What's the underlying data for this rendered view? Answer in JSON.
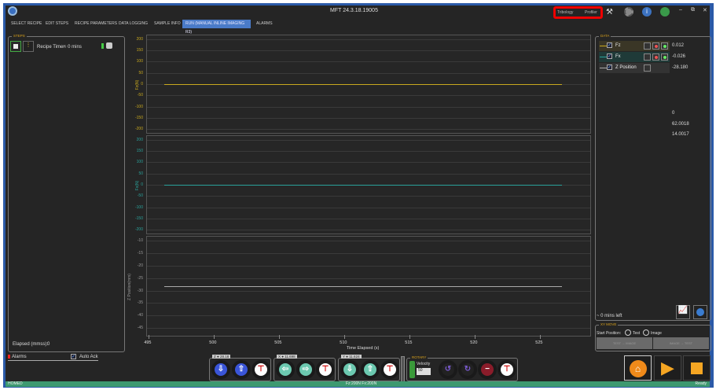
{
  "title": "MFT 24.3.18.19005",
  "header_links": [
    "Tribology",
    "Profiler"
  ],
  "tabs": [
    "SELECT RECIPE",
    "EDIT STEPS",
    "RECIPE PARAMETERS",
    "DATA LOGGING",
    "SAMPLE INFO",
    "RUN (MANUAL INLINE IMAGING R3)",
    "ALARMS"
  ],
  "active_tab": 5,
  "steps": {
    "label": "STEPS",
    "recipe_timer_label": "Recipe Timer:",
    "recipe_timer_value": "~ 0 mins",
    "elapsed_label": "Elapsed (mmss):",
    "elapsed_value": "0"
  },
  "alarms": {
    "label": "Alarms",
    "auto_ack": "Auto Ack"
  },
  "data_panel": {
    "label": "DATA",
    "rows": [
      {
        "name": "Fz",
        "value": "0.012",
        "color": "#c8a81e"
      },
      {
        "name": "Fx",
        "value": "-0.026",
        "color": "#2aa19a"
      },
      {
        "name": "Z Position",
        "value": "-28.180",
        "color": "#aaaaaa"
      }
    ],
    "extra_values": [
      "0",
      "62.0018",
      "14.0017"
    ],
    "mins_left": "~ 0  mins left"
  },
  "xy_move": {
    "label": "XY MOVE",
    "start_position": "Start Position:",
    "opt_test": "Test",
    "opt_image": "Image",
    "btn1_from": "TEST",
    "btn1_to": "IMAGE",
    "btn2_from": "IMAGE",
    "btn2_to": "TEST"
  },
  "axes": {
    "z": {
      "label": "Z",
      "value": "28.18"
    },
    "x": {
      "label": "X",
      "value": "11.698"
    },
    "y": {
      "label": "Y",
      "value": "11.624"
    },
    "rotary": {
      "label": "ROTARY",
      "velocity_label": "Velocity",
      "velocity": "50"
    }
  },
  "status": {
    "left": "HOMED",
    "center": "Fz:200N Fx:200N",
    "right": "Ready"
  },
  "chart_data": [
    {
      "type": "line",
      "ylabel": "Fz(N)",
      "ylim": [
        -210,
        210
      ],
      "yticks": [
        200,
        150,
        100,
        50,
        0,
        -50,
        -100,
        -150,
        -200
      ],
      "color": "#c8a81e",
      "x": [
        496.2,
        526.7
      ],
      "y": [
        0,
        0
      ]
    },
    {
      "type": "line",
      "ylabel": "Fx(N)",
      "ylim": [
        -210,
        210
      ],
      "yticks": [
        200,
        150,
        100,
        50,
        0,
        -50,
        -100,
        -150,
        -200
      ],
      "color": "#2aa19a",
      "x": [
        496.2,
        526.7
      ],
      "y": [
        0,
        0
      ]
    },
    {
      "type": "line",
      "ylabel": "Z Position(mm)",
      "ylim": [
        -47.5,
        -9
      ],
      "yticks": [
        -10,
        -15,
        -20,
        -25,
        -30,
        -35,
        -40,
        -45
      ],
      "color": "#aaaaaa",
      "x": [
        496.2,
        526.7
      ],
      "y": [
        -28.18,
        -28.18
      ]
    }
  ],
  "xaxis": {
    "label": "Time Elapsed (s)",
    "xlim": [
      494.8,
      528.9
    ],
    "ticks": [
      495,
      500,
      505,
      510,
      515,
      520,
      525
    ]
  }
}
